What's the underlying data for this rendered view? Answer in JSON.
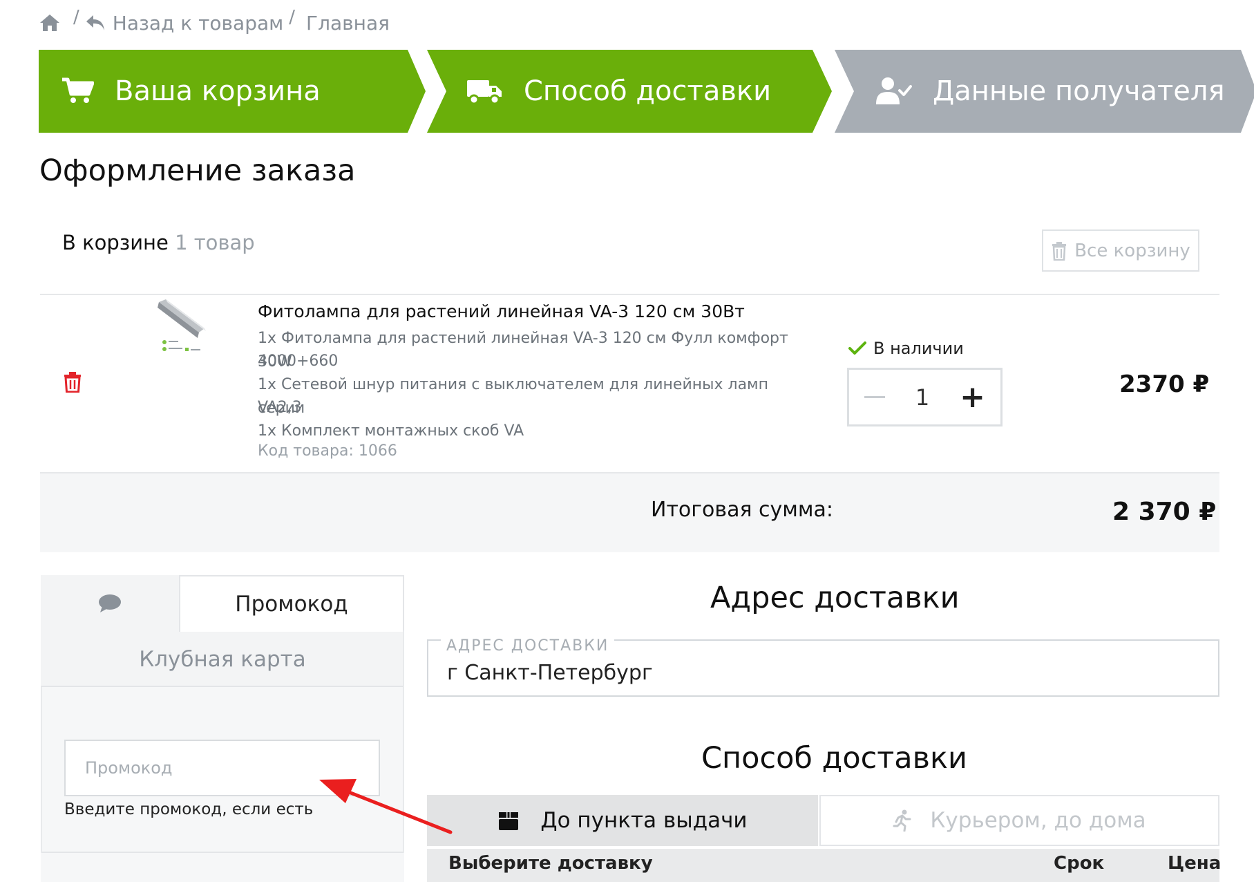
{
  "breadcrumb": {
    "back_label": "Назад к товарам",
    "main_label": "Главная",
    "separator": "/"
  },
  "steps": [
    {
      "label": "Ваша корзина",
      "icon": "cart-icon",
      "state": "done"
    },
    {
      "label": "Способ доставки",
      "icon": "truck-icon",
      "state": "active"
    },
    {
      "label": "Данные получателя",
      "icon": "user-check-icon",
      "state": "pending"
    }
  ],
  "colors": {
    "step_active": "#6aaf0a",
    "step_pending": "#a7adb4",
    "delete_red": "#e3242b",
    "check_green": "#5db30f",
    "arrow_red": "#ea1f1f"
  },
  "page_title": "Оформление заказа",
  "cart": {
    "prefix": "В корзине",
    "count": "1 товар",
    "clear_label": "Все корзину"
  },
  "item": {
    "title": "Фитолампа для растений линейная VA-3 120 см 30Вт",
    "lines": [
      "1х Фитолампа для растений линейная VA-3 120 см Фулл комфорт 30W",
      "4000+660",
      "1х Сетевой шнур питания с выключателем для линейных ламп серии",
      "VA2,3",
      "1х Комплект монтажных скоб VA"
    ],
    "code": "Код товара: 1066",
    "stock": "В наличии",
    "quantity": "1",
    "price": "2370 ₽"
  },
  "total": {
    "label": "Итоговая сумма:",
    "value": "2 370 ₽"
  },
  "promo_panel": {
    "tab_promo": "Промокод",
    "tab_club": "Клубная карта",
    "input_placeholder": "Промокод",
    "input_value": "",
    "hint": "Введите промокод, если есть"
  },
  "address": {
    "title": "Адрес доставки",
    "field_label": "АДРЕС ДОСТАВКИ",
    "field_value": "г Санкт-Петербург"
  },
  "shipping": {
    "title": "Способ доставки",
    "tab_pickup": "До пункта выдачи",
    "tab_courier": "Курьером, до дома",
    "columns": [
      "Выберите доставку",
      "Срок",
      "Цена"
    ]
  }
}
